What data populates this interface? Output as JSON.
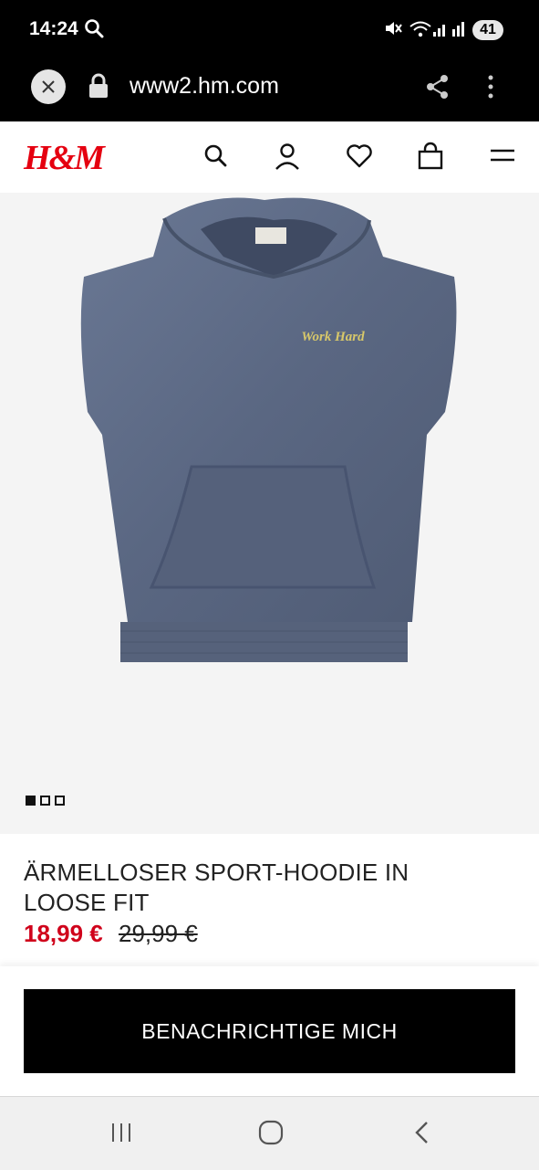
{
  "status_bar": {
    "time": "14:24",
    "battery": "41"
  },
  "browser": {
    "url": "www2.hm.com"
  },
  "header": {
    "logo": "H&M"
  },
  "product": {
    "title": "ÄRMELLOSER SPORT-HOODIE IN LOOSE FIT",
    "price_sale": "18,99 €",
    "price_original": "29,99 €",
    "print_text": "Work Hard",
    "image_count": 3,
    "active_image": 1,
    "colors": {
      "hoodie": "#5d6b85",
      "accent_red": "#e50010",
      "sale_price": "#d0021b"
    }
  },
  "cta": {
    "label": "BENACHRICHTIGE MICH"
  }
}
